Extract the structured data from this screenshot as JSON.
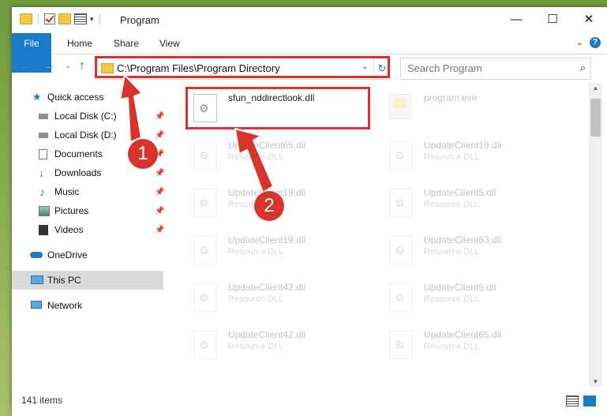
{
  "window": {
    "title": "Program",
    "minimize": "—",
    "maximize": "☐",
    "close": "✕"
  },
  "ribbon": {
    "tabs": [
      "File",
      "Home",
      "Share",
      "View"
    ],
    "help": "?"
  },
  "address": {
    "path": "C:\\Program Files\\Program Directory",
    "search_placeholder": "Search Program"
  },
  "sidebar": {
    "items": [
      {
        "label": "Quick access",
        "icon": "star-icon"
      },
      {
        "label": "Local Disk (C:)",
        "icon": "drive-icon",
        "pinned": true
      },
      {
        "label": "Local Disk (D:)",
        "icon": "drive-icon",
        "pinned": true
      },
      {
        "label": "Documents",
        "icon": "documents-icon",
        "pinned": true
      },
      {
        "label": "Downloads",
        "icon": "download-icon",
        "pinned": true
      },
      {
        "label": "Music",
        "icon": "music-icon",
        "pinned": true
      },
      {
        "label": "Pictures",
        "icon": "pictures-icon",
        "pinned": true
      },
      {
        "label": "Videos",
        "icon": "videos-icon",
        "pinned": true
      },
      {
        "label": "OneDrive",
        "icon": "cloud-icon"
      },
      {
        "label": "This PC",
        "icon": "computer-icon",
        "selected": true
      },
      {
        "label": "Network",
        "icon": "network-icon"
      }
    ]
  },
  "files": [
    {
      "name": "sfun_nddirectlook.dll",
      "type": ""
    },
    {
      "name": "program.exe",
      "type": ""
    },
    {
      "name": "UpdateClient65.dll",
      "type": "Resource DLL"
    },
    {
      "name": "UpdateClient19.dll",
      "type": "Resource DLL"
    },
    {
      "name": "UpdateClient19.dll",
      "type": "Resource DLL"
    },
    {
      "name": "UpdateClient5.dll",
      "type": "Resource DLL"
    },
    {
      "name": "UpdateClient19.dll",
      "type": "Resource DLL"
    },
    {
      "name": "UpdateClient63.dll",
      "type": "Resource DLL"
    },
    {
      "name": "UpdateClient42.dll",
      "type": "Resource DLL"
    },
    {
      "name": "UpdateClient5.dll",
      "type": "Resource DLL"
    },
    {
      "name": "UpdateClient42.dll",
      "type": "Resource DLL"
    },
    {
      "name": "UpdateClient65.dll",
      "type": "Resource DLL"
    }
  ],
  "markers": {
    "first": "1",
    "second": "2"
  },
  "status": {
    "item_count": "141 items"
  },
  "colors": {
    "accent": "#1979ca",
    "highlight": "#d9342b"
  }
}
